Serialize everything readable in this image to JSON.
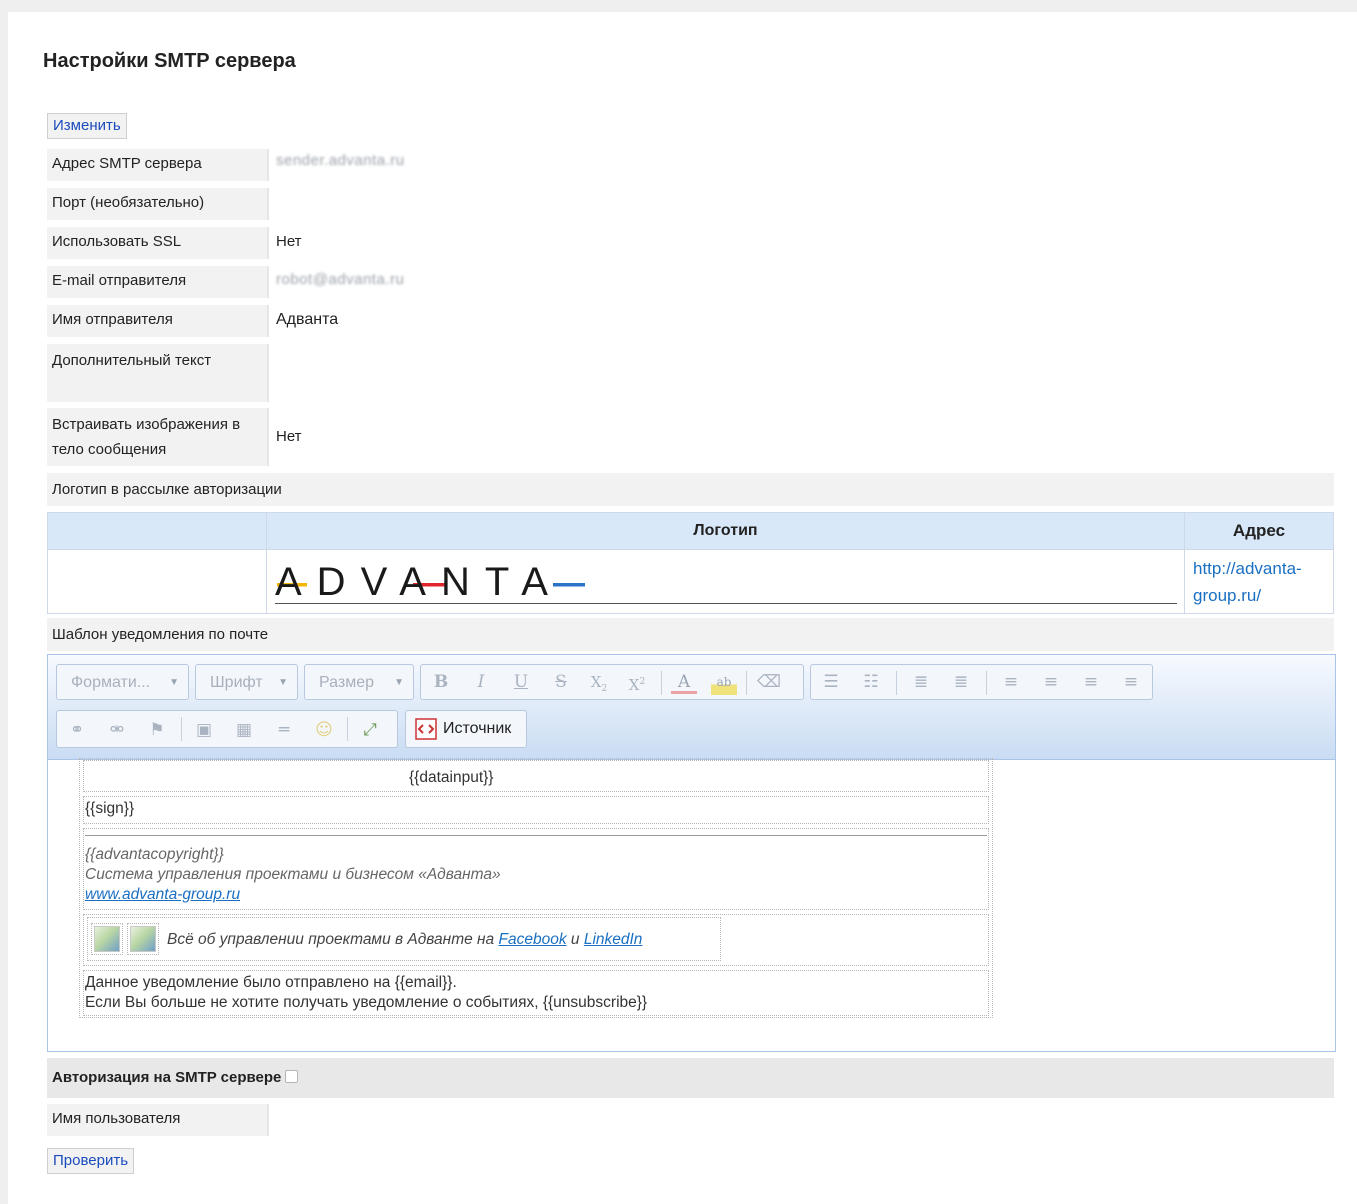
{
  "title": "Настройки SMTP сервера",
  "edit_button": "Изменить",
  "fields": [
    {
      "label": "Адрес SMTP сервера",
      "value": "sender.advanta.ru"
    },
    {
      "label": "Порт (необязательно)",
      "value": ""
    },
    {
      "label": "Использовать SSL",
      "value": "Нет"
    },
    {
      "label": "E-mail отправителя",
      "value": "robot@advanta.ru"
    },
    {
      "label": "Имя отправителя",
      "value": "Адванта"
    },
    {
      "label": "Дополнительный текст",
      "value": ""
    },
    {
      "label": "Встраивать изображения в тело сообщения",
      "value": "Нет"
    }
  ],
  "logo_section": {
    "label": "Логотип в рассылке авторизации",
    "col_logo": "Логотип",
    "col_address": "Адрес",
    "logo_text": "ADVANTA",
    "address": "http://advanta-group.ru/"
  },
  "template_section": {
    "label": "Шаблон уведомления по почте"
  },
  "editor": {
    "format_label": "Формати...",
    "font_label": "Шрифт",
    "size_label": "Размер",
    "source_label": "Источник",
    "content": {
      "datainput": "{{datainput}}",
      "sign": "{{sign}}",
      "copyright": "{{advantacopyright}}",
      "system_line": "Система управления проектами и бизнесом «Адванта»",
      "site_link": "www.advanta-group.ru",
      "social_text": "Всё об управлении проектами в Адванте на",
      "facebook": "Facebook",
      "and": "и",
      "linkedin": "LinkedIn",
      "notice_line1": "Данное уведомление было отправлено на {{email}}.",
      "notice_line2": "Если Вы больше не хотите получать уведомление о событиях, {{unsubscribe}}"
    }
  },
  "auth": {
    "label": "Авторизация на SMTP сервере",
    "username_label": "Имя пользователя"
  },
  "check_button": "Проверить",
  "colors": {
    "link": "#1a6fc2",
    "button_text": "#1a4bbd",
    "header_blue": "#d9e8f8",
    "logo_yellow": "#f2b705",
    "logo_red": "#e0262b",
    "logo_blue": "#2a73c9"
  }
}
